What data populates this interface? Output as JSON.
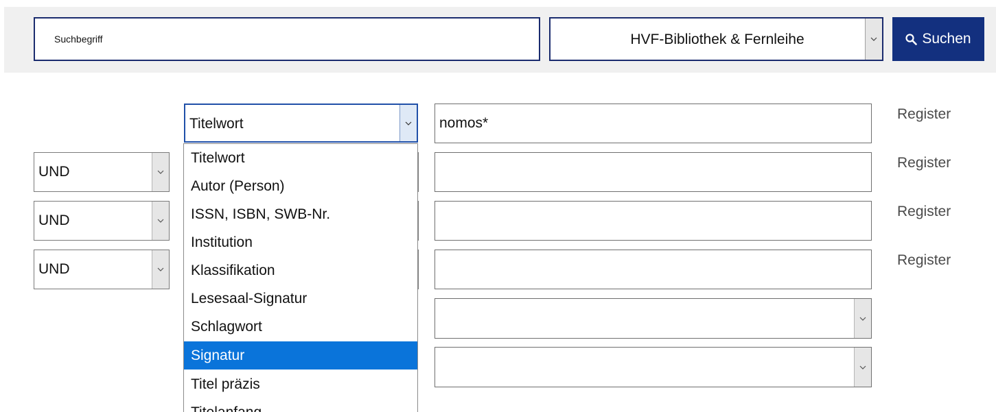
{
  "search": {
    "query_value": "Suchbegriff",
    "library_select": "HVF-Bibliothek & Fernleihe",
    "search_button": "Suchen"
  },
  "advanced": {
    "field_select": "Titelwort",
    "field_options": [
      "Titelwort",
      "Autor (Person)",
      "ISSN, ISBN, SWB-Nr.",
      "Institution",
      "Klassifikation",
      "Lesesaal-Signatur",
      "Schlagwort",
      "Signatur",
      "Titel präzis",
      "Titelanfang"
    ],
    "highlighted_option": "Signatur",
    "operators": [
      "UND",
      "UND",
      "UND"
    ],
    "term_values": [
      "nomos*",
      "",
      "",
      ""
    ],
    "register_label": "Register"
  },
  "icons": {
    "search": "magnifier-icon",
    "dropdown": "chevron-down-icon"
  },
  "colors": {
    "accent": "#13307f",
    "selection": "#0a74da",
    "topbar": "#f0f0f0"
  }
}
